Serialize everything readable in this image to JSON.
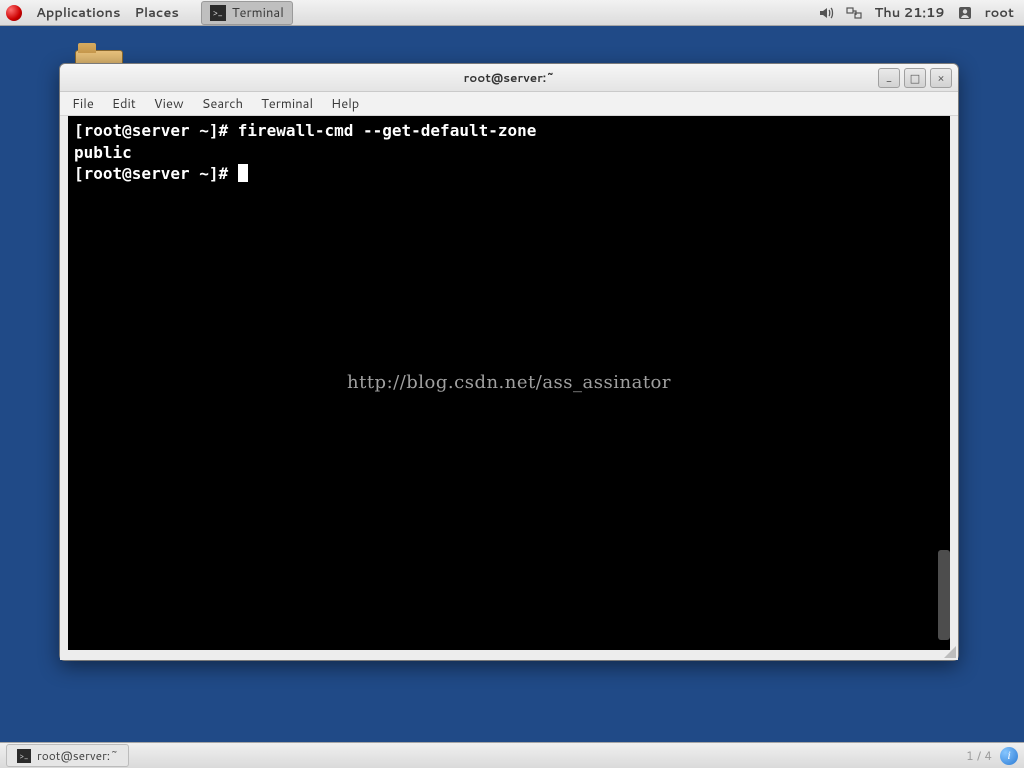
{
  "panel": {
    "applications": "Applications",
    "places": "Places",
    "task": "Terminal",
    "clock": "Thu 21:19",
    "user": "root"
  },
  "window": {
    "title": "root@server:~",
    "menus": {
      "file": "File",
      "edit": "Edit",
      "view": "View",
      "search": "Search",
      "terminal": "Terminal",
      "help": "Help"
    },
    "buttons": {
      "min": "_",
      "max": "□",
      "close": "×"
    }
  },
  "terminal": {
    "prompt1": "[root@server ~]# ",
    "cmd1": "firewall-cmd --get-default-zone",
    "out1": "public",
    "prompt2": "[root@server ~]# ",
    "watermark": "http://blog.csdn.net/ass_assinator"
  },
  "bottom": {
    "task": "root@server:~",
    "pager": "1 / 4"
  }
}
